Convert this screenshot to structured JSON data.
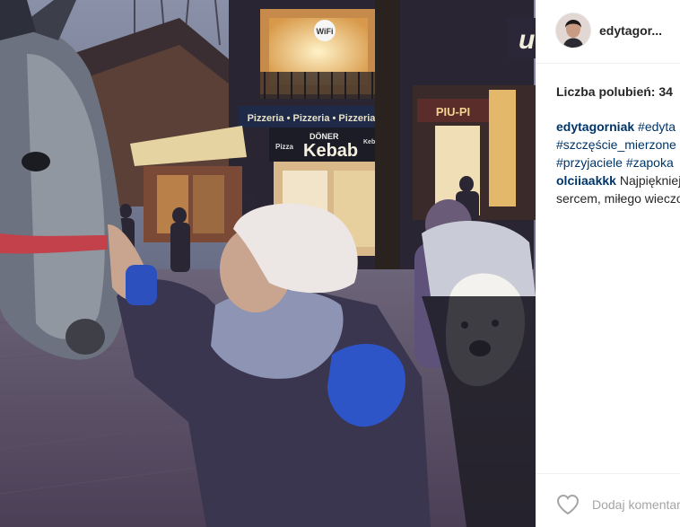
{
  "post": {
    "username": "edytagor...",
    "likes_label": "Liczba polubień: 34",
    "caption": {
      "user": "edytagorniak",
      "tags_line1": "#edyta",
      "tags_line2": "#szczęście_mierzone",
      "tags_line3": "#przyjaciele #zapoka"
    },
    "comment": {
      "user": "olciiaakkk",
      "text_line1": "Najpiękniej",
      "text_line2": "sercem, miłego wieczo"
    },
    "add_comment_placeholder": "Dodaj komentarz..."
  },
  "photo": {
    "signs": {
      "wifi": "WiFi",
      "pizzeria": "Pizzeria • Pizzeria • Pizzeria",
      "doner": "DÖNER",
      "kebab": "Kebab",
      "pizza": "Pizza",
      "kebab_small": "Kebab",
      "piu": "PIU-PI",
      "u": "u"
    }
  },
  "icons": {
    "heart": "heart-icon",
    "avatar": "avatar"
  },
  "colors": {
    "username": "#262626",
    "link": "#003569",
    "placeholder": "#a5a5a5"
  }
}
